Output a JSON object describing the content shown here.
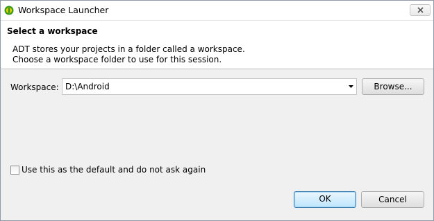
{
  "window": {
    "title": "Workspace Launcher",
    "icon": "eclipse-app-icon",
    "close_icon": "close-icon"
  },
  "header": {
    "title": "Select a workspace",
    "description_line1": "ADT stores your projects in a folder called a workspace.",
    "description_line2": "Choose a workspace folder to use for this session."
  },
  "workspace": {
    "label": "Workspace:",
    "value": "D:\\Android",
    "dropdown_icon": "dropdown-arrow-icon",
    "browse_label": "Browse..."
  },
  "options": {
    "default_checkbox_label": "Use this as the default and do not ask again",
    "default_checked": false
  },
  "actions": {
    "ok_label": "OK",
    "cancel_label": "Cancel"
  },
  "colors": {
    "accent_ok_border": "#3c7fb1",
    "body_background": "#f0f0f0",
    "icon_green": "#3a9a1c",
    "icon_yellow": "#f0d000"
  }
}
